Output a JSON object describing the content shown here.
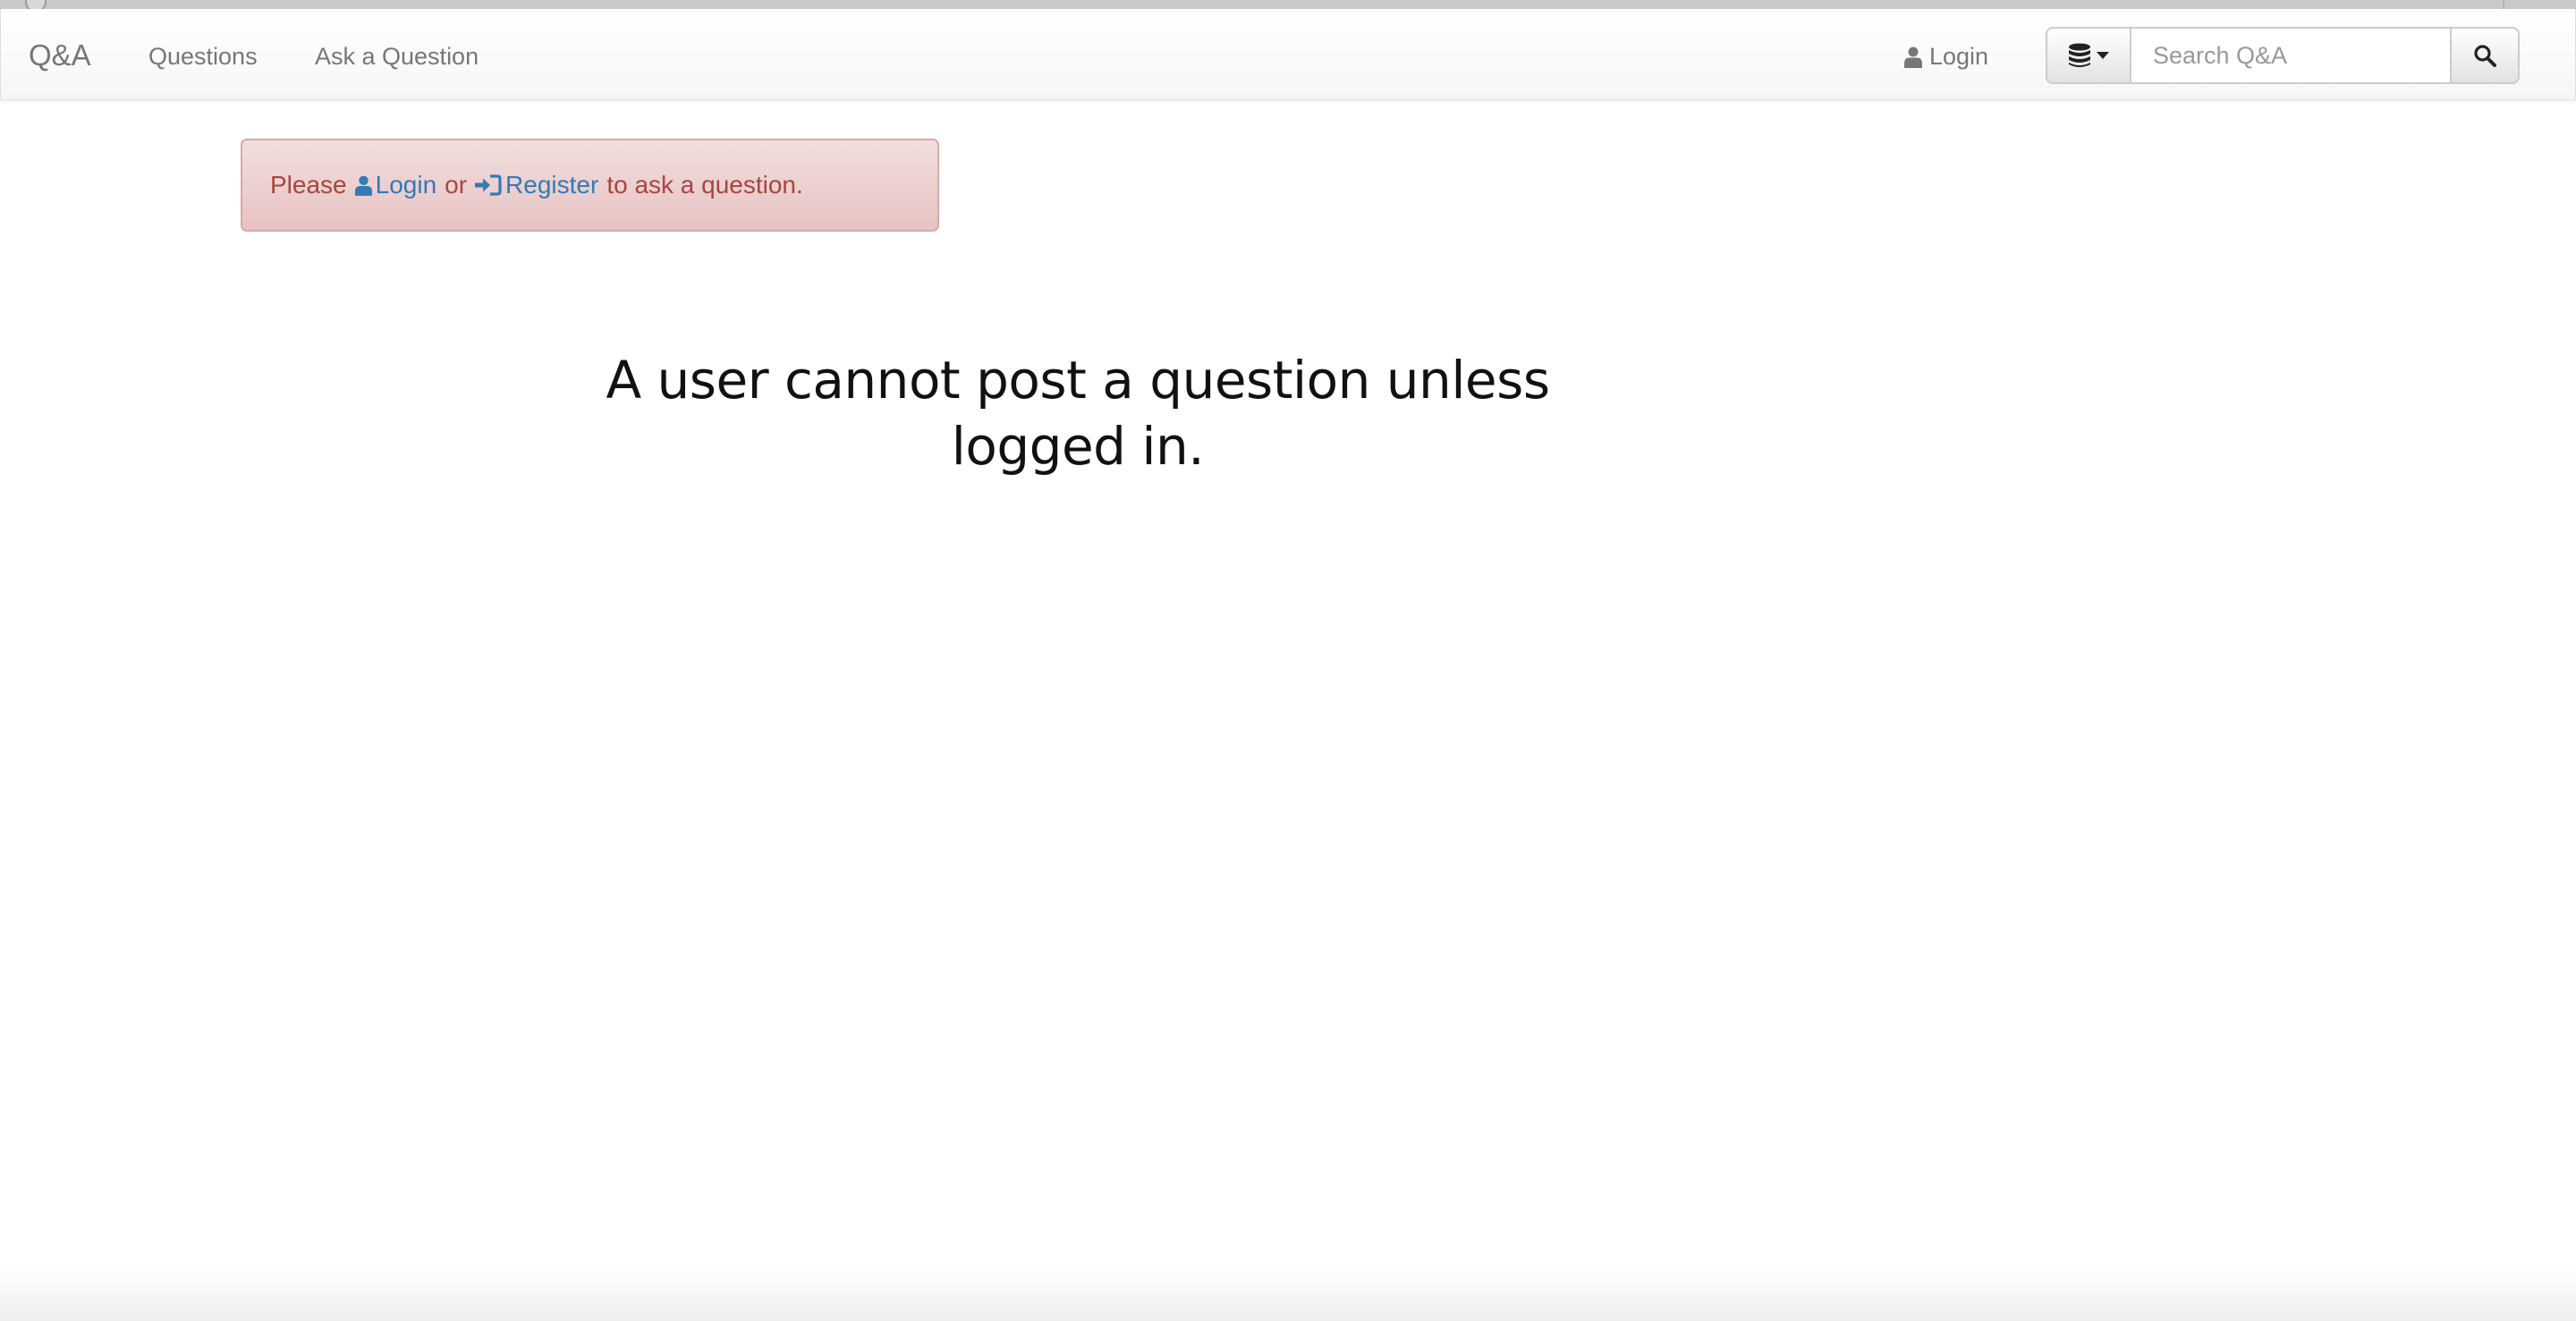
{
  "navbar": {
    "brand": "Q&A",
    "links": [
      "Questions",
      "Ask a Question"
    ],
    "login_label": "Login",
    "search_placeholder": "Search Q&A"
  },
  "alert": {
    "prefix": "Please",
    "login_label": "Login",
    "or_text": "or",
    "register_label": "Register",
    "suffix": "to ask a question."
  },
  "caption": "A user cannot post a question unless logged in.",
  "icons": {
    "nav_login": "user-icon",
    "db_dropdown": "database-icon",
    "dropdown_caret": "caret-down-icon",
    "search": "search-icon",
    "alert_login": "user-icon",
    "alert_register": "sign-in-icon"
  },
  "colors": {
    "alert_text": "#a94442",
    "link": "#337ab7",
    "nav_text": "#777777"
  }
}
